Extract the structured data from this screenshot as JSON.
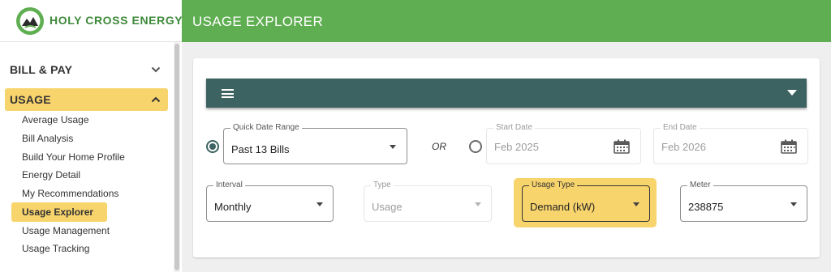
{
  "brand": {
    "name": "HOLY CROSS ENERGY",
    "accent": "#5fae52",
    "highlight": "#f8d46d",
    "panel_color": "#3c6361"
  },
  "header": {
    "title": "USAGE EXPLORER"
  },
  "sidebar": {
    "sections": [
      {
        "label": "BILL & PAY",
        "expanded": false,
        "chevron": "chevron-down-icon"
      },
      {
        "label": "USAGE",
        "expanded": true,
        "chevron": "chevron-up-icon"
      }
    ],
    "usage_items": [
      {
        "label": "Average Usage"
      },
      {
        "label": "Bill Analysis"
      },
      {
        "label": "Build Your Home Profile"
      },
      {
        "label": "Energy Detail"
      },
      {
        "label": "My Recommendations"
      },
      {
        "label": "Usage Explorer",
        "active": true
      },
      {
        "label": "Usage Management"
      },
      {
        "label": "Usage Tracking"
      }
    ]
  },
  "filters": {
    "quick_date_range": {
      "label": "Quick Date Range",
      "value": "Past 13 Bills",
      "selected": true
    },
    "or_label": "OR",
    "start_date": {
      "label": "Start Date",
      "value": "Feb 2025"
    },
    "end_date": {
      "label": "End Date",
      "value": "Feb 2026"
    },
    "interval": {
      "label": "Interval",
      "value": "Monthly"
    },
    "type": {
      "label": "Type",
      "value": "Usage",
      "disabled": true
    },
    "usage_type": {
      "label": "Usage Type",
      "value": "Demand (kW)"
    },
    "meter": {
      "label": "Meter",
      "value": "238875"
    }
  }
}
